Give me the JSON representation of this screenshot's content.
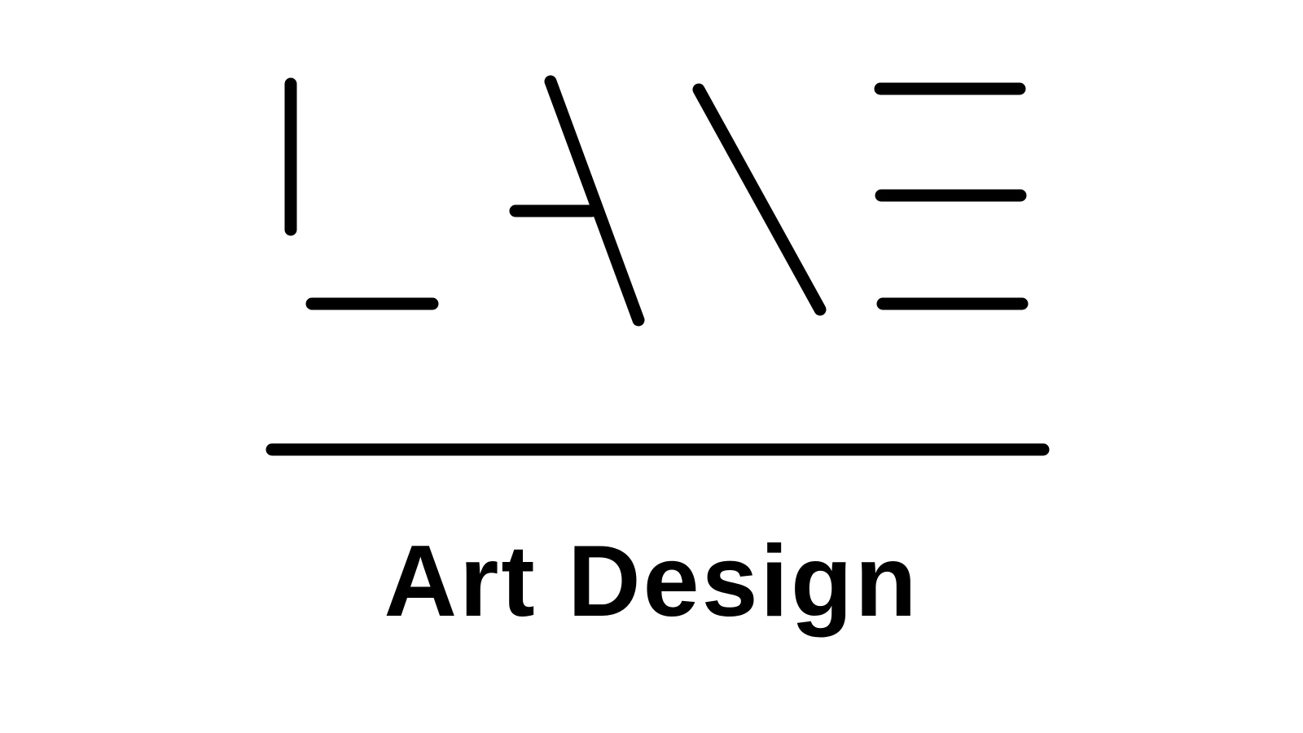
{
  "colors": {
    "background": "#ffffff",
    "ink": "#000000"
  },
  "logo": {
    "mark_name": "LANE",
    "caption": "Art Design"
  }
}
